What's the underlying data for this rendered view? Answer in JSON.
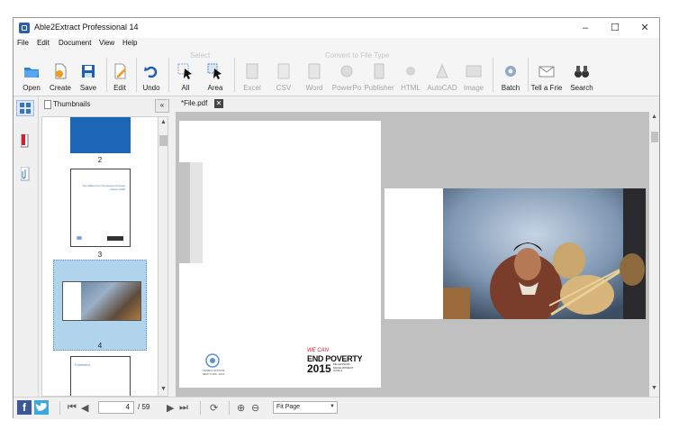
{
  "window": {
    "title": "Able2Extract Professional 14"
  },
  "window_controls": {
    "minimize": "–",
    "maximize": "☐",
    "close": "✕"
  },
  "menu": [
    "File",
    "Edit",
    "Document",
    "View",
    "Help"
  ],
  "toolbar": {
    "groups": {
      "select": "Select",
      "convert": "Convert to File Type"
    },
    "open": "Open",
    "create": "Create",
    "save": "Save",
    "edit": "Edit",
    "undo": "Undo",
    "all": "All",
    "area": "Area",
    "excel": "Excel",
    "csv": "CSV",
    "word": "Word",
    "powerpoint": "PowerPo",
    "publisher": "Publisher",
    "html": "HTML",
    "autocad": "AutoCAD",
    "image": "Image",
    "batch": "Batch",
    "tell_friend": "Tell a Frie",
    "search": "Search"
  },
  "thumbnails": {
    "title": "Thumbnails",
    "pages": [
      {
        "number": "2"
      },
      {
        "number": "3",
        "heading": "The Millennium Development Goals Report 2015"
      },
      {
        "number": "4"
      },
      {
        "heading": "Foreword"
      }
    ]
  },
  "document": {
    "tab_name": "*File.pdf",
    "left_page": {
      "un_logo_text": "UNITED NATIONS\nNEW YORK, 2015",
      "logo_line1": "WE CAN",
      "logo_line2": "END POVERTY",
      "logo_line3": "2015",
      "logo_sub": "MILLENNIUM\nDEVELOPMENT\nGOALS"
    }
  },
  "statusbar": {
    "current_page": "4",
    "total_pages": "/ 59",
    "zoom_mode": "Fit Page"
  },
  "colors": {
    "accent_blue": "#2b5fad",
    "selection": "#b0d4ec"
  }
}
